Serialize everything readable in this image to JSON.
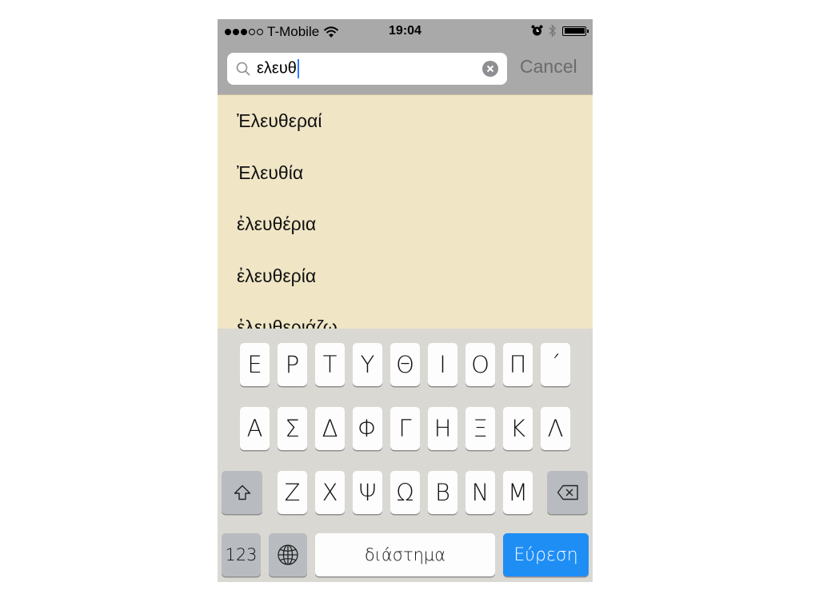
{
  "status_bar": {
    "carrier": "T-Mobile",
    "time": "19:04",
    "signal_bars_filled": 3,
    "signal_bars_total": 5
  },
  "search": {
    "query": "ελευθ",
    "cancel_label": "Cancel"
  },
  "results": [
    "Ἐλευθεραί",
    "Ἐλευθία",
    "ἐλευθέρια",
    "ἐλευθερία",
    "ἐλευθεριάζω"
  ],
  "keyboard": {
    "row1": [
      "Ε",
      "Ρ",
      "Τ",
      "Υ",
      "Θ",
      "Ι",
      "Ο",
      "Π",
      "´"
    ],
    "row2": [
      "Α",
      "Σ",
      "Δ",
      "Φ",
      "Γ",
      "Η",
      "Ξ",
      "Κ",
      "Λ"
    ],
    "row3": [
      "Ζ",
      "Χ",
      "Ψ",
      "Ω",
      "Β",
      "Ν",
      "Μ"
    ],
    "numbers_label": "123",
    "space_label": "διάστημα",
    "search_label": "Εύρεση"
  },
  "colors": {
    "results_background": "#f0e6c6",
    "keyboard_background": "#dad8d3",
    "search_key": "#1e8ef5",
    "status_bar": "#a9a9a9"
  }
}
